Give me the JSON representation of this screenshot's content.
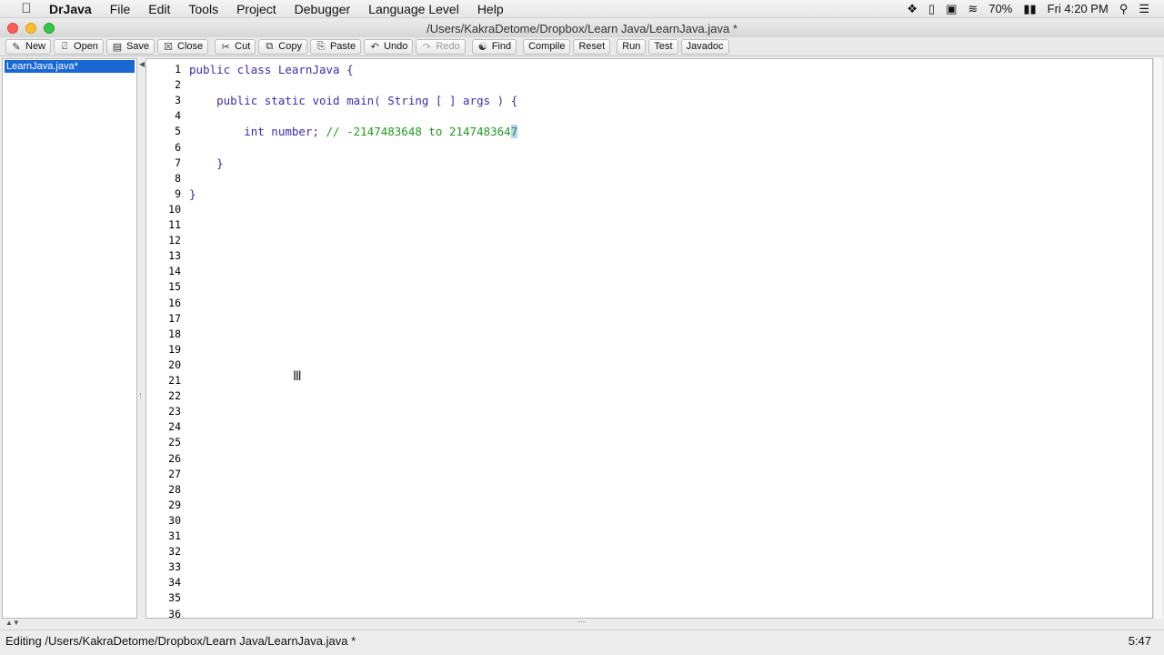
{
  "menubar": {
    "apple_icon": "",
    "app_name": "DrJava",
    "items": [
      "File",
      "Edit",
      "Tools",
      "Project",
      "Debugger",
      "Language Level",
      "Help"
    ],
    "status": {
      "dropbox_icon": "dropbox-icon",
      "battery": "70%",
      "clock": "Fri 4:20 PM"
    }
  },
  "window": {
    "title": "/Users/KakraDetome/Dropbox/Learn Java/LearnJava.java *"
  },
  "toolbar": {
    "new": "New",
    "open": "Open",
    "save": "Save",
    "close": "Close",
    "cut": "Cut",
    "copy": "Copy",
    "paste": "Paste",
    "undo": "Undo",
    "redo": "Redo",
    "find": "Find",
    "compile": "Compile",
    "reset": "Reset",
    "run": "Run",
    "test": "Test",
    "javadoc": "Javadoc"
  },
  "doclist": {
    "items": [
      "LearnJava.java*"
    ]
  },
  "editor": {
    "lines": [
      {
        "n": "1",
        "code": "public class LearnJava {"
      },
      {
        "n": "2",
        "code": ""
      },
      {
        "n": "3",
        "code": "    public static void main( String [ ] args ) {"
      },
      {
        "n": "4",
        "code": ""
      },
      {
        "n": "5",
        "code": "        int number; ",
        "comment": "// -2147483648 to 214748364",
        "selected": "7"
      },
      {
        "n": "6",
        "code": ""
      },
      {
        "n": "7",
        "code": "    }"
      },
      {
        "n": "8",
        "code": ""
      },
      {
        "n": "9",
        "code": "}"
      },
      {
        "n": "10",
        "code": ""
      },
      {
        "n": "11",
        "code": ""
      },
      {
        "n": "12",
        "code": ""
      },
      {
        "n": "13",
        "code": ""
      },
      {
        "n": "14",
        "code": ""
      },
      {
        "n": "15",
        "code": ""
      },
      {
        "n": "16",
        "code": ""
      },
      {
        "n": "17",
        "code": ""
      },
      {
        "n": "18",
        "code": ""
      },
      {
        "n": "19",
        "code": ""
      },
      {
        "n": "20",
        "code": ""
      },
      {
        "n": "21",
        "code": ""
      },
      {
        "n": "22",
        "code": ""
      },
      {
        "n": "23",
        "code": ""
      },
      {
        "n": "24",
        "code": ""
      },
      {
        "n": "25",
        "code": ""
      },
      {
        "n": "26",
        "code": ""
      },
      {
        "n": "27",
        "code": ""
      },
      {
        "n": "28",
        "code": ""
      },
      {
        "n": "29",
        "code": ""
      },
      {
        "n": "30",
        "code": ""
      },
      {
        "n": "31",
        "code": ""
      },
      {
        "n": "32",
        "code": ""
      },
      {
        "n": "33",
        "code": ""
      },
      {
        "n": "34",
        "code": ""
      },
      {
        "n": "35",
        "code": ""
      },
      {
        "n": "36",
        "code": ""
      }
    ]
  },
  "statusbar": {
    "text": "Editing /Users/KakraDetome/Dropbox/Learn Java/LearnJava.java *",
    "position": "5:47"
  }
}
